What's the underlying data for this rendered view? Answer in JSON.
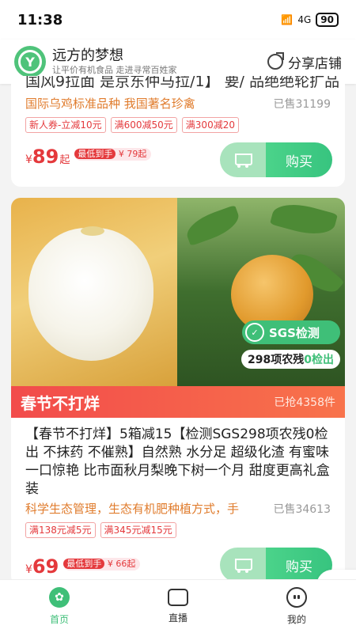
{
  "status_bar": {
    "time": "11:38",
    "network": "4G",
    "battery": "90"
  },
  "header": {
    "logo_glyph": "Y",
    "shop_name": "远方的梦想",
    "shop_slogan": "让平价有机食品 走进寻常百姓家",
    "share_label": "分享店铺"
  },
  "product1": {
    "title_cut": "国风9拉面 是京东仲马拉/1】 要/ 品绝绝轮扩品",
    "slogan": "国际乌鸡标准品种 我国著名珍禽",
    "sold": "已售31199",
    "coupons": [
      "新人券-立减10元",
      "满600减50元",
      "满300减20"
    ],
    "currency": "¥",
    "price": "89",
    "price_suffix": "起",
    "lowest_label": "最低到手",
    "lowest_price": "¥ 79起",
    "buy_label": "购买"
  },
  "product2": {
    "sgs_label": "SGS检测",
    "test_prefix": "298项农残",
    "test_highlight": "0检出",
    "banner_title": "春节不打烊",
    "grabbed": "已抢4358件",
    "description": "【春节不打烊】5箱减15【检测SGS298项农残0检出 不抹药 不催熟】自然熟 水分足 超级化渣 有蜜味 一口惊艳 比市面秋月梨晚下树一个月 甜度更高礼盒装",
    "slogan": "科学生态管理，生态有机肥种植方式，手",
    "sold": "已售34613",
    "coupons": [
      "满138元减5元",
      "满345元减15元"
    ],
    "currency": "¥",
    "price": "69",
    "lowest_label": "最低到手",
    "lowest_price": "¥ 66起",
    "buy_label": "购买"
  },
  "tabbar": {
    "tabs": [
      {
        "label": "首页",
        "icon": "home-sprout-icon",
        "active": true
      },
      {
        "label": "直播",
        "icon": "live-tv-icon",
        "active": false
      },
      {
        "label": "我的",
        "icon": "profile-face-icon",
        "active": false
      }
    ]
  },
  "colors": {
    "brand_green": "#3fbf78",
    "price_red": "#e4393c",
    "slogan_orange": "#e07c2d"
  }
}
